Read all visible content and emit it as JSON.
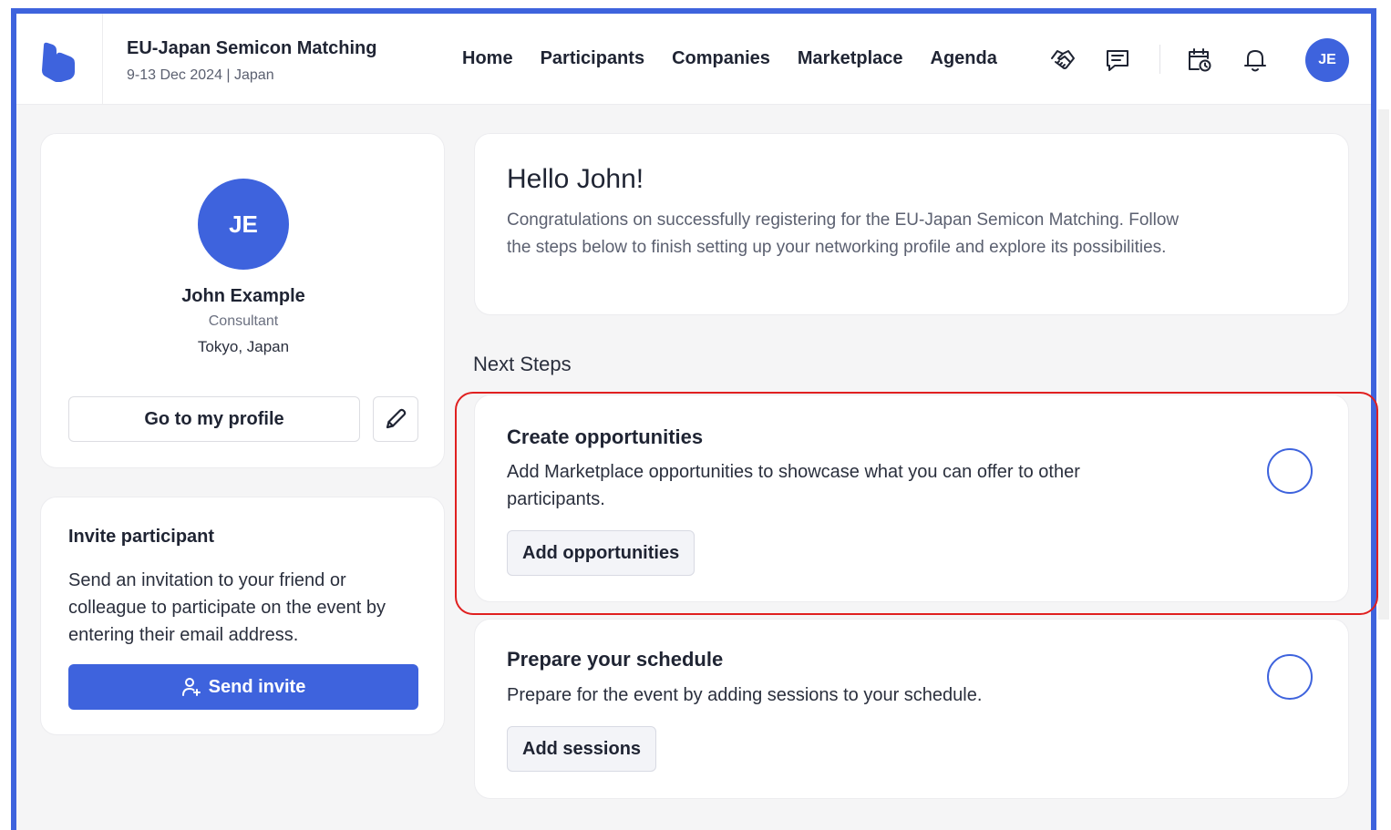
{
  "header": {
    "event_title": "EU-Japan Semicon Matching",
    "event_subtitle": "9-13 Dec 2024 | Japan",
    "nav": [
      "Home",
      "Participants",
      "Companies",
      "Marketplace",
      "Agenda"
    ],
    "icons": [
      "handshake-icon",
      "chat-icon",
      "calendar-clock-icon",
      "bell-icon"
    ],
    "avatar_initials": "JE"
  },
  "profile": {
    "initials": "JE",
    "name": "John Example",
    "role": "Consultant",
    "location": "Tokyo, Japan",
    "go_profile_label": "Go to my profile"
  },
  "invite": {
    "title": "Invite participant",
    "text": "Send an invitation to your friend or colleague to participate on the event by entering their email address.",
    "button_label": "Send invite"
  },
  "hello": {
    "title": "Hello John!",
    "text": "Congratulations on successfully registering for the EU-Japan Semicon Matching. Follow the steps below to finish setting up your networking profile and explore its possibilities."
  },
  "next_steps": {
    "heading": "Next Steps",
    "steps": [
      {
        "title": "Create opportunities",
        "text": "Add Marketplace opportunities to showcase what you can offer to other participants.",
        "button_label": "Add opportunities"
      },
      {
        "title": "Prepare your schedule",
        "text": "Prepare for the event by adding sessions to your schedule.",
        "button_label": "Add sessions"
      }
    ]
  },
  "colors": {
    "accent": "#3e63dd",
    "highlight": "#e02020",
    "background": "#f5f5f6"
  }
}
